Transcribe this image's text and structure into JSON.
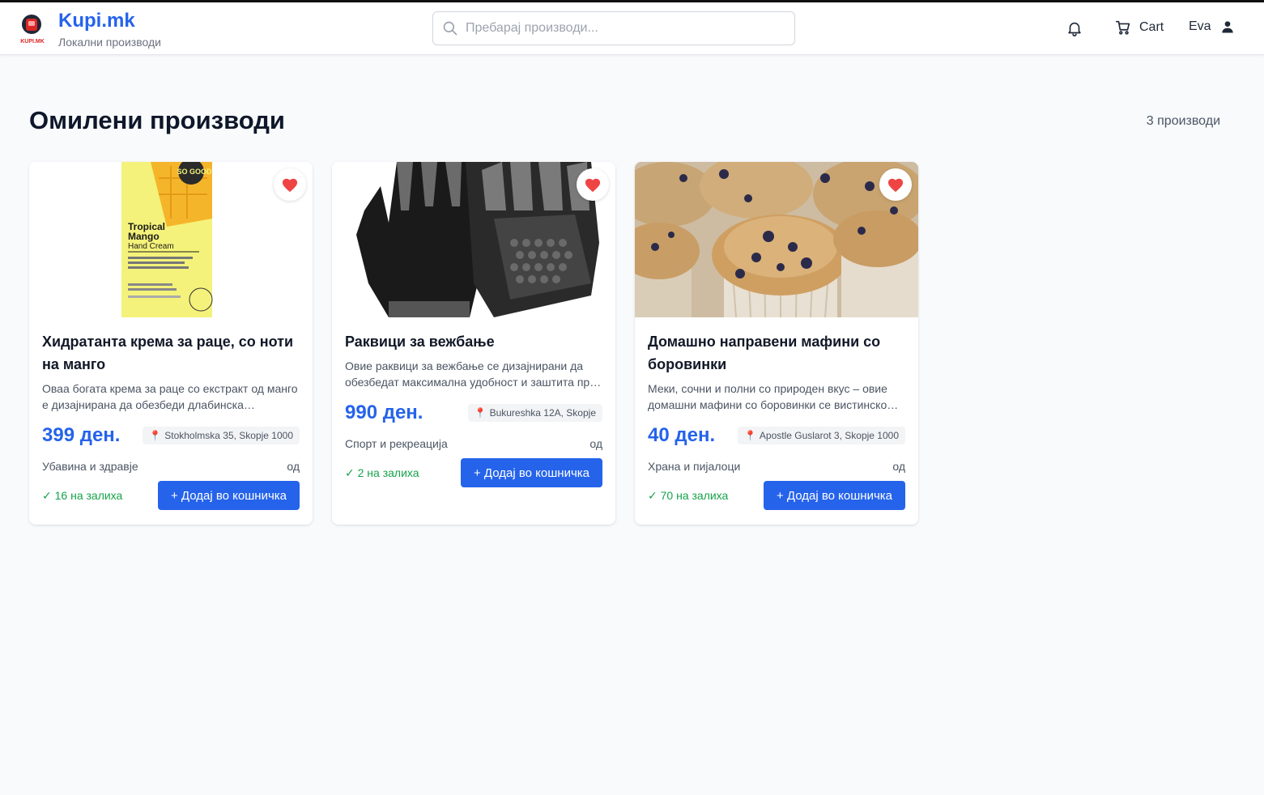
{
  "header": {
    "brand": "Kupi.mk",
    "tagline": "Локални производи",
    "logo_text": "KUPI.MK",
    "search_placeholder": "Пребарај производи...",
    "cart_label": "Cart",
    "user_name": "Eva"
  },
  "page": {
    "title": "Омилени производи",
    "count": "3 производи"
  },
  "products": [
    {
      "name": "Хидратанта крема за раце, со ноти на манго",
      "description": "Оваа богата крема за раце со екстракт од манго е дизајнирана да обезбеди длабинска хидратација.",
      "price": "399 ден.",
      "location": "Stokholmska 35, Skopje 1000",
      "category": "Убавина и здравје",
      "seller_prefix": "од",
      "stock": "✓ 16 на залиха",
      "add_label": "+ Додај во кошничка",
      "image_text": {
        "line1": "Tropical",
        "line2": "Mango",
        "line3": "Hand Cream",
        "badge": "SO GOOD"
      }
    },
    {
      "name": "Раквици за вежбање",
      "description": "Овие раквици за вежбање се дизајнирани да обезбедат максимална удобност и заштита при тренинг.",
      "price": "990 ден.",
      "location": "Bukureshka 12A, Skopje",
      "category": "Спорт и рекреација",
      "seller_prefix": "од",
      "stock": "✓ 2 на залиха",
      "add_label": "+ Додај во кошничка"
    },
    {
      "name": "Домашно направени мафини со боровинки",
      "description": "Меки, сочни и полни со природен вкус – овие домашни мафини со боровинки се вистинско задоволство.",
      "price": "40 ден.",
      "location": "Apostle Guslarot 3, Skopje 1000",
      "category": "Храна и пијалоци",
      "seller_prefix": "од",
      "stock": "✓ 70 на залиха",
      "add_label": "+ Додај во кошничка"
    }
  ],
  "colors": {
    "accent": "#2563eb",
    "favorite": "#ef4444",
    "in_stock": "#16a34a"
  },
  "icons": [
    "search-icon",
    "bell-icon",
    "cart-icon",
    "user-icon",
    "heart-icon",
    "pin-icon"
  ]
}
